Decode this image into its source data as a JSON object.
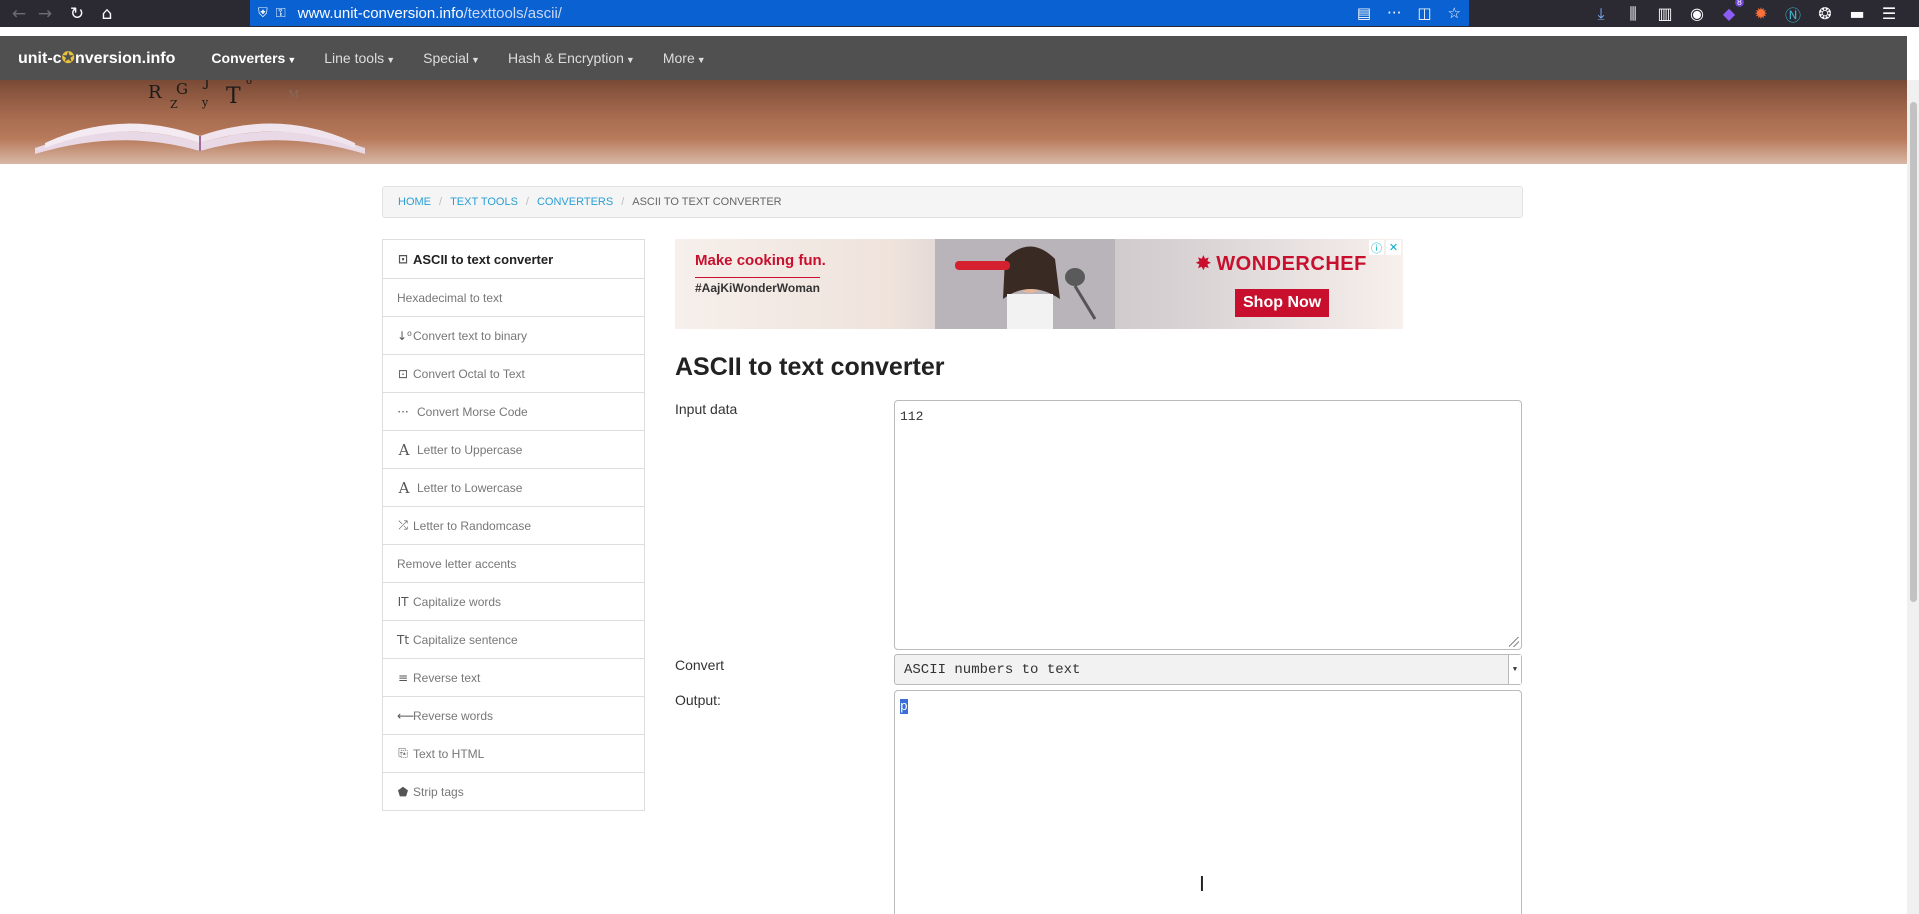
{
  "browser": {
    "url_host": "www.unit-conversion.info",
    "url_path": "/texttools/ascii/",
    "extension_badge": "8"
  },
  "site": {
    "logo_pre": "unit-c",
    "logo_post": "nversion.info",
    "nav": [
      {
        "label": "Converters",
        "active": true
      },
      {
        "label": "Line tools"
      },
      {
        "label": "Special"
      },
      {
        "label": "Hash & Encryption"
      },
      {
        "label": "More"
      }
    ]
  },
  "breadcrumb": {
    "home": "HOME",
    "text_tools": "TEXT TOOLS",
    "converters": "CONVERTERS",
    "current": "ASCII TO TEXT CONVERTER"
  },
  "sidebar": {
    "items": [
      {
        "label": "ASCII to text converter",
        "icon": "ascii-icon",
        "glyph": "⊡",
        "active": true
      },
      {
        "label": "Hexadecimal to text",
        "icon": "",
        "glyph": ""
      },
      {
        "label": "Convert text to binary",
        "icon": "sort-numeric-icon",
        "glyph": "↓⁰"
      },
      {
        "label": "Convert Octal to Text",
        "icon": "octal-icon",
        "glyph": "⊡"
      },
      {
        "label": "Convert Morse Code",
        "icon": "morse-dots-icon",
        "glyph": "···"
      },
      {
        "label": "Letter to Uppercase",
        "icon": "letter-a-icon",
        "glyph": "A"
      },
      {
        "label": "Letter to Lowercase",
        "icon": "letter-a-icon",
        "glyph": "A"
      },
      {
        "label": "Letter to Randomcase",
        "icon": "shuffle-icon",
        "glyph": "⤮"
      },
      {
        "label": "Remove letter accents",
        "icon": "",
        "glyph": ""
      },
      {
        "label": "Capitalize words",
        "icon": "text-cursor-icon",
        "glyph": "IT"
      },
      {
        "label": "Capitalize sentence",
        "icon": "text-size-icon",
        "glyph": "Tt"
      },
      {
        "label": "Reverse text",
        "icon": "align-icon",
        "glyph": "≡"
      },
      {
        "label": "Reverse words",
        "icon": "arrow-left-icon",
        "glyph": "⟵"
      },
      {
        "label": "Text to HTML",
        "icon": "copy-icon",
        "glyph": "⎘"
      },
      {
        "label": "Strip tags",
        "icon": "tags-icon",
        "glyph": "⬟"
      }
    ]
  },
  "ad": {
    "headline": "Make cooking fun.",
    "hashtag": "#AajKiWonderWoman",
    "brand": "WONDERCHEF",
    "cta": "Shop Now"
  },
  "main": {
    "title": "ASCII to text converter",
    "input_label": "Input data",
    "input_value": "112",
    "convert_label": "Convert",
    "convert_selected": "ASCII numbers to text",
    "output_label": "Output:",
    "output_value": "p"
  }
}
